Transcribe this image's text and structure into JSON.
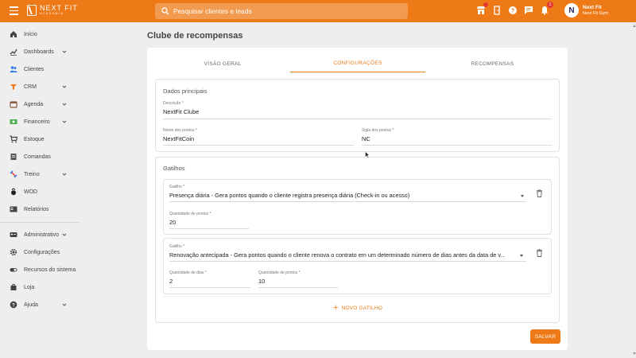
{
  "header": {
    "logo_main": "NEXT FIT",
    "logo_sub": "ACADEMIA",
    "search_placeholder": "Pesquisar clientes e leads",
    "notification_count": "1",
    "user_name": "Next Fit",
    "user_gym": "Next Fit Gym",
    "avatar_letter": "N"
  },
  "sidebar": {
    "items": [
      {
        "label": "Início",
        "icon": "home-icon"
      },
      {
        "label": "Dashboards",
        "icon": "chart-icon"
      },
      {
        "label": "Clientes",
        "icon": "people-icon"
      },
      {
        "label": "CRM",
        "icon": "crm-icon"
      },
      {
        "label": "Agenda",
        "icon": "calendar-icon"
      },
      {
        "label": "Financeiro",
        "icon": "money-icon"
      },
      {
        "label": "Estoque",
        "icon": "cart-icon"
      },
      {
        "label": "Comandas",
        "icon": "receipt-icon"
      },
      {
        "label": "Treino",
        "icon": "dumbbell-icon"
      },
      {
        "label": "WOD",
        "icon": "kettlebell-icon"
      },
      {
        "label": "Relatórios",
        "icon": "report-icon"
      },
      {
        "label": "Administrativo",
        "icon": "id-card-icon"
      },
      {
        "label": "Configurações",
        "icon": "gear-icon"
      },
      {
        "label": "Recursos do sistema",
        "icon": "toggle-icon"
      },
      {
        "label": "Loja",
        "icon": "shop-icon"
      },
      {
        "label": "Ajuda",
        "icon": "help-icon"
      }
    ]
  },
  "main": {
    "title": "Clube de recompensas",
    "tabs": [
      {
        "label": "VISÃO GERAL"
      },
      {
        "label": "CONFIGURAÇÕES"
      },
      {
        "label": "RECOMPENSAS"
      }
    ],
    "dados": {
      "title": "Dados principais",
      "descricao_label": "Descrição *",
      "descricao_value": "NextFit Clube",
      "nome_label": "Nome dos pontos *",
      "nome_value": "NextFitCoin",
      "sigla_label": "Sigla dos pontos *",
      "sigla_value": "NC"
    },
    "gatilhos": {
      "title": "Gatilhos",
      "items": [
        {
          "gatilho_label": "Gatilho *",
          "gatilho_value": "Presença diária - Gera pontos quando o cliente registra presença diária (Check-in ou acesso)",
          "pontos_label": "Quantidade de pontos *",
          "pontos_value": "20"
        },
        {
          "gatilho_label": "Gatilho *",
          "gatilho_value": "Renovação antecipada - Gera pontos quando o cliente renova o contrato em um determinado número de dias antes da data de v...",
          "dias_label": "Quantidade de dias *",
          "dias_value": "2",
          "pontos_label": "Quantidade de pontos *",
          "pontos_value": "10"
        }
      ],
      "add_label": "NOVO GATILHO"
    },
    "save_label": "SALVAR"
  },
  "colors": {
    "accent": "#ee7a17",
    "badge": "#e53935"
  }
}
